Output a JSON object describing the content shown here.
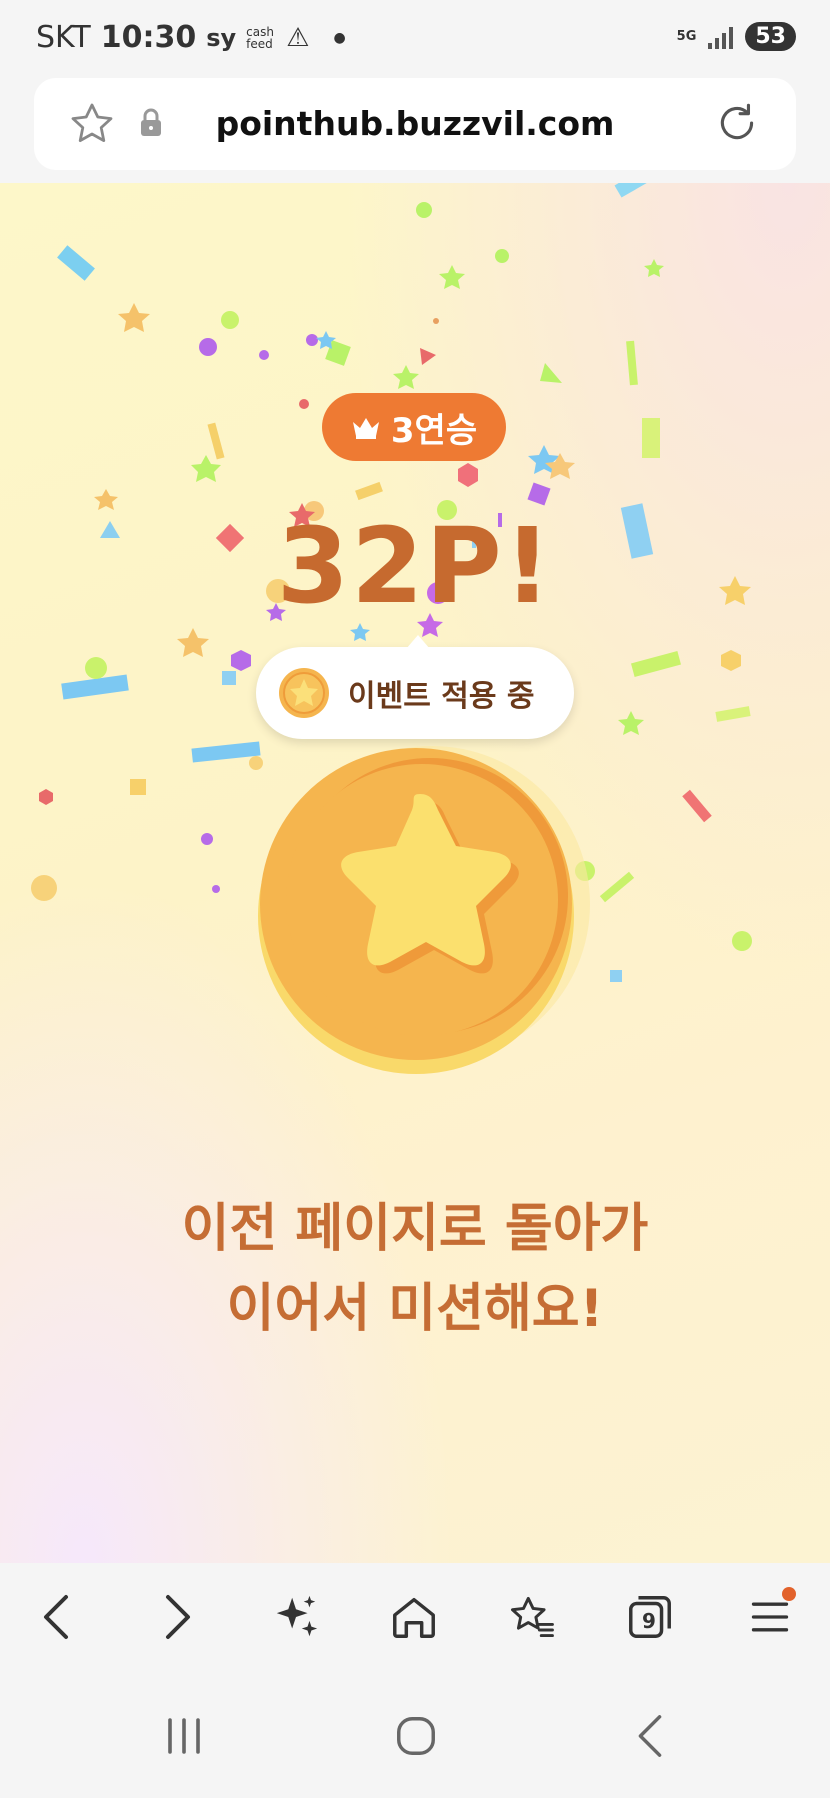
{
  "status_bar": {
    "carrier": "SKT",
    "time": "10:30",
    "app_icon_sy": "sy",
    "app_icon_cashfeed": "cash feed",
    "network": "5G",
    "battery": "53"
  },
  "browser": {
    "url": "pointhub.buzzvil.com",
    "icons": [
      "bookmark-star-icon",
      "lock-icon",
      "reload-icon"
    ]
  },
  "reward": {
    "streak_label": "3연승",
    "points_text": "32P!",
    "event_label": "이벤트 적용 중",
    "message_line1": "이전 페이지로 돌아가",
    "message_line2": "이어서 미션해요!"
  },
  "bottom_nav": {
    "tabs_count": "9",
    "items": [
      "back-icon",
      "forward-icon",
      "sparkle-icon",
      "home-icon",
      "bookmarks-icon",
      "tabs-icon",
      "menu-icon"
    ]
  },
  "colors": {
    "accent_orange": "#ee7a33",
    "points_text": "#c66a2f",
    "message_text": "#c56d34",
    "coin": "#f5b54e"
  }
}
